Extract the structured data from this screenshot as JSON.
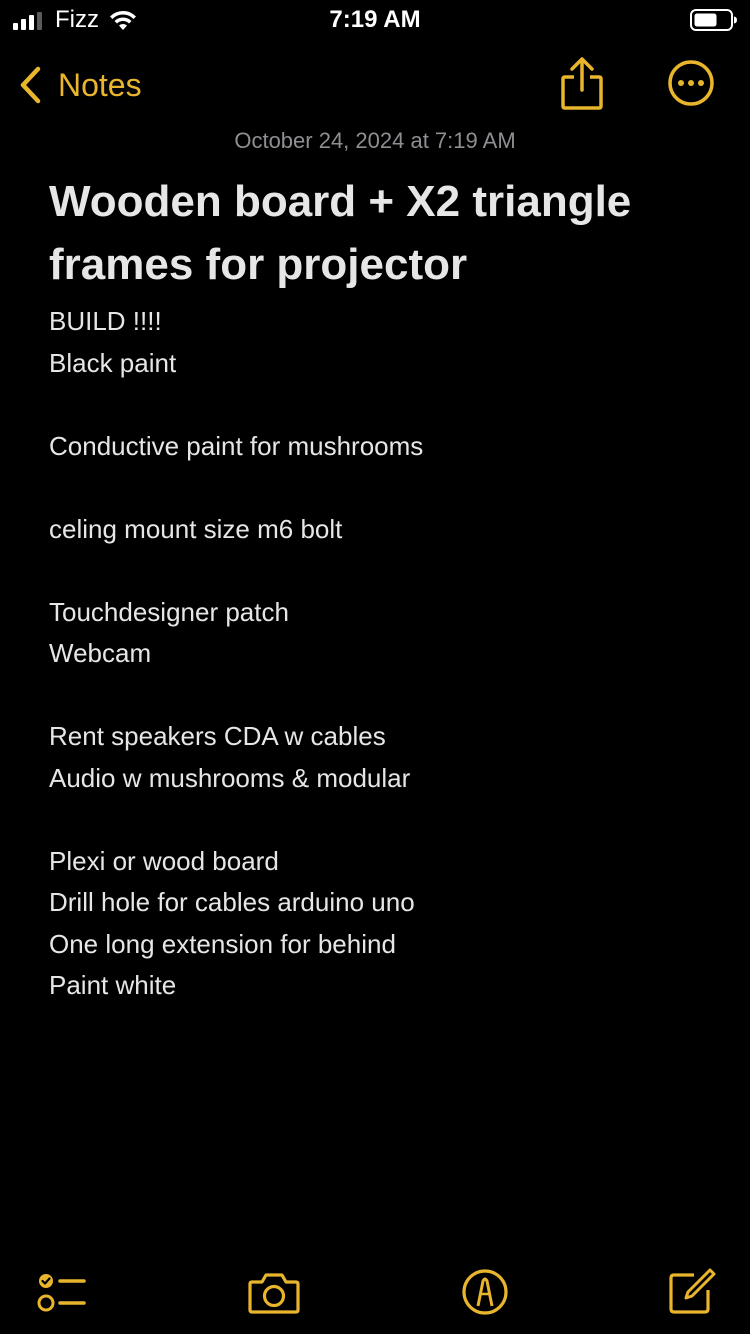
{
  "theme": {
    "accent": "#e8b52d",
    "background": "#000000",
    "text": "#e6e6e6",
    "muted": "#8e8e93"
  },
  "status_bar": {
    "carrier": "Fizz",
    "time": "7:19 AM",
    "signal_icon": "cellular-signal-icon",
    "wifi_icon": "wifi-icon",
    "battery_icon": "battery-icon"
  },
  "nav": {
    "back_label": "Notes",
    "back_icon": "chevron-left-icon",
    "share_icon": "share-icon",
    "more_icon": "more-icon"
  },
  "note": {
    "date": "October 24, 2024 at 7:19 AM",
    "title": "Wooden board + X2 triangle frames for projector",
    "lines": [
      "BUILD !!!!",
      "Black paint",
      "",
      "Conductive paint for mushrooms",
      "",
      "celing mount size m6 bolt",
      "",
      "Touchdesigner patch",
      "Webcam",
      "",
      "Rent speakers CDA w cables",
      "Audio w mushrooms & modular",
      "",
      "Plexi or wood board",
      "Drill hole for cables arduino uno",
      "One long extension for behind",
      "Paint white"
    ]
  },
  "toolbar": {
    "checklist_icon": "checklist-icon",
    "camera_icon": "camera-icon",
    "markup_icon": "markup-icon",
    "compose_icon": "compose-icon"
  }
}
